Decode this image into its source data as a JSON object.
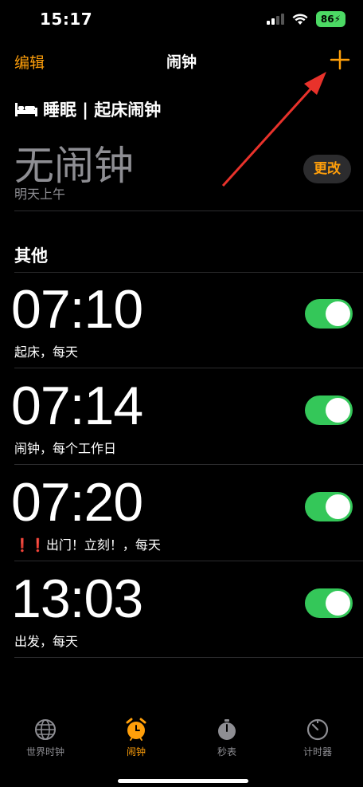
{
  "status_bar": {
    "time": "15:17",
    "battery": "86"
  },
  "nav": {
    "edit": "编辑",
    "title": "闹钟"
  },
  "sleep": {
    "header": "睡眠 | 起床闹钟",
    "no_alarm": "无闹钟",
    "sub": "明天上午",
    "change": "更改"
  },
  "other_header": "其他",
  "alarms": [
    {
      "time": "07:10",
      "label": "起床，每天",
      "enabled": true
    },
    {
      "time": "07:14",
      "label": "闹钟，每个工作日",
      "enabled": true
    },
    {
      "time": "07:20",
      "label_prefix": "❗️❗️",
      "label": "出门！立刻！，每天",
      "enabled": true
    },
    {
      "time": "13:03",
      "label": "出发，每天",
      "enabled": true
    }
  ],
  "tabs": [
    {
      "label": "世界时钟",
      "icon": "globe-icon",
      "active": false
    },
    {
      "label": "闹钟",
      "icon": "alarm-clock-icon",
      "active": true
    },
    {
      "label": "秒表",
      "icon": "stopwatch-icon",
      "active": false
    },
    {
      "label": "计时器",
      "icon": "timer-icon",
      "active": false
    }
  ],
  "colors": {
    "accent": "#ff9f0a",
    "toggle_on": "#34c759",
    "separator": "#2c2c2e",
    "secondary_text": "#8e8e93"
  }
}
